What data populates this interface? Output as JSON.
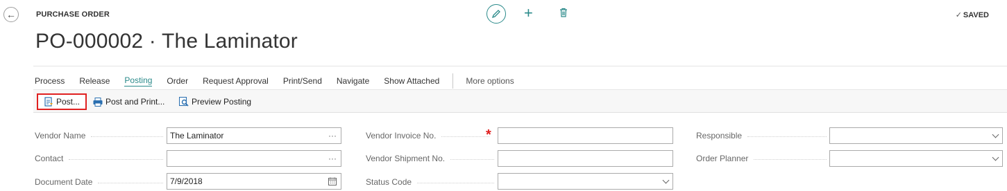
{
  "header": {
    "caption": "PURCHASE ORDER",
    "title": "PO-000002 · The Laminator",
    "saved_label": "SAVED",
    "saved_check": "✓"
  },
  "menu": {
    "items": [
      "Process",
      "Release",
      "Posting",
      "Order",
      "Request Approval",
      "Print/Send",
      "Navigate",
      "Show Attached"
    ],
    "active": "Posting",
    "more_label": "More options"
  },
  "actions": {
    "post": "Post...",
    "post_and_print": "Post and Print...",
    "preview_posting": "Preview Posting"
  },
  "fields": {
    "vendor_name": {
      "label": "Vendor Name",
      "value": "The Laminator"
    },
    "contact": {
      "label": "Contact",
      "value": ""
    },
    "document_date": {
      "label": "Document Date",
      "value": "7/9/2018"
    },
    "vendor_invoice_no": {
      "label": "Vendor Invoice No.",
      "value": "",
      "required_mark": "*"
    },
    "vendor_shipment_no": {
      "label": "Vendor Shipment No.",
      "value": ""
    },
    "status_code": {
      "label": "Status Code",
      "value": ""
    },
    "responsible": {
      "label": "Responsible",
      "value": ""
    },
    "order_planner": {
      "label": "Order Planner",
      "value": ""
    }
  },
  "ellipsis": "···",
  "colors": {
    "accent": "#2a8a8a",
    "highlight": "#e02020",
    "text": "#212121"
  }
}
